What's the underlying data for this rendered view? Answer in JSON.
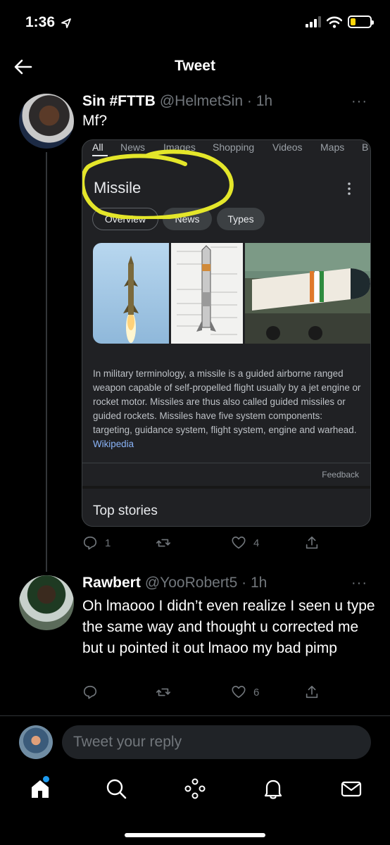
{
  "status": {
    "time": "1:36"
  },
  "header": {
    "title": "Tweet"
  },
  "tweet": {
    "name": "Sin #FTTB",
    "handle": "@HelmetSin · 1h",
    "text": "Mf?",
    "more": "···",
    "stats": {
      "replies": "1",
      "retweets": "",
      "likes": "4"
    }
  },
  "card": {
    "tabs": [
      "All",
      "News",
      "Images",
      "Shopping",
      "Videos",
      "Maps",
      "B"
    ],
    "title": "Missile",
    "chips": [
      "Overview",
      "News",
      "Types"
    ],
    "description": "In military terminology, a missile is a guided airborne ranged weapon capable of self-propelled flight usually by a jet engine or rocket motor. Missiles are thus also called guided missiles or guided rockets. Missiles have five system components: targeting, guidance system, flight system, engine and warhead.",
    "source": "Wikipedia",
    "feedback": "Feedback",
    "top_stories": "Top stories",
    "highlight_color": "#e4e62a"
  },
  "reply": {
    "name": "Rawbert",
    "handle": "@YooRobert5 · 1h",
    "more": "···",
    "text": "Oh lmaooo I didn’t even realize I seen u type the same way and thought u corrected me but u pointed it out lmaoo my bad pimp",
    "stats": {
      "replies": "",
      "retweets": "",
      "likes": "6"
    }
  },
  "composer": {
    "placeholder": "Tweet your reply"
  },
  "tabbar": [
    "home-icon",
    "search-icon",
    "spaces-icon",
    "notifications-icon",
    "messages-icon"
  ],
  "colors": {
    "accent": "#1d9bf0",
    "muted": "#71767b",
    "background": "#000000"
  }
}
